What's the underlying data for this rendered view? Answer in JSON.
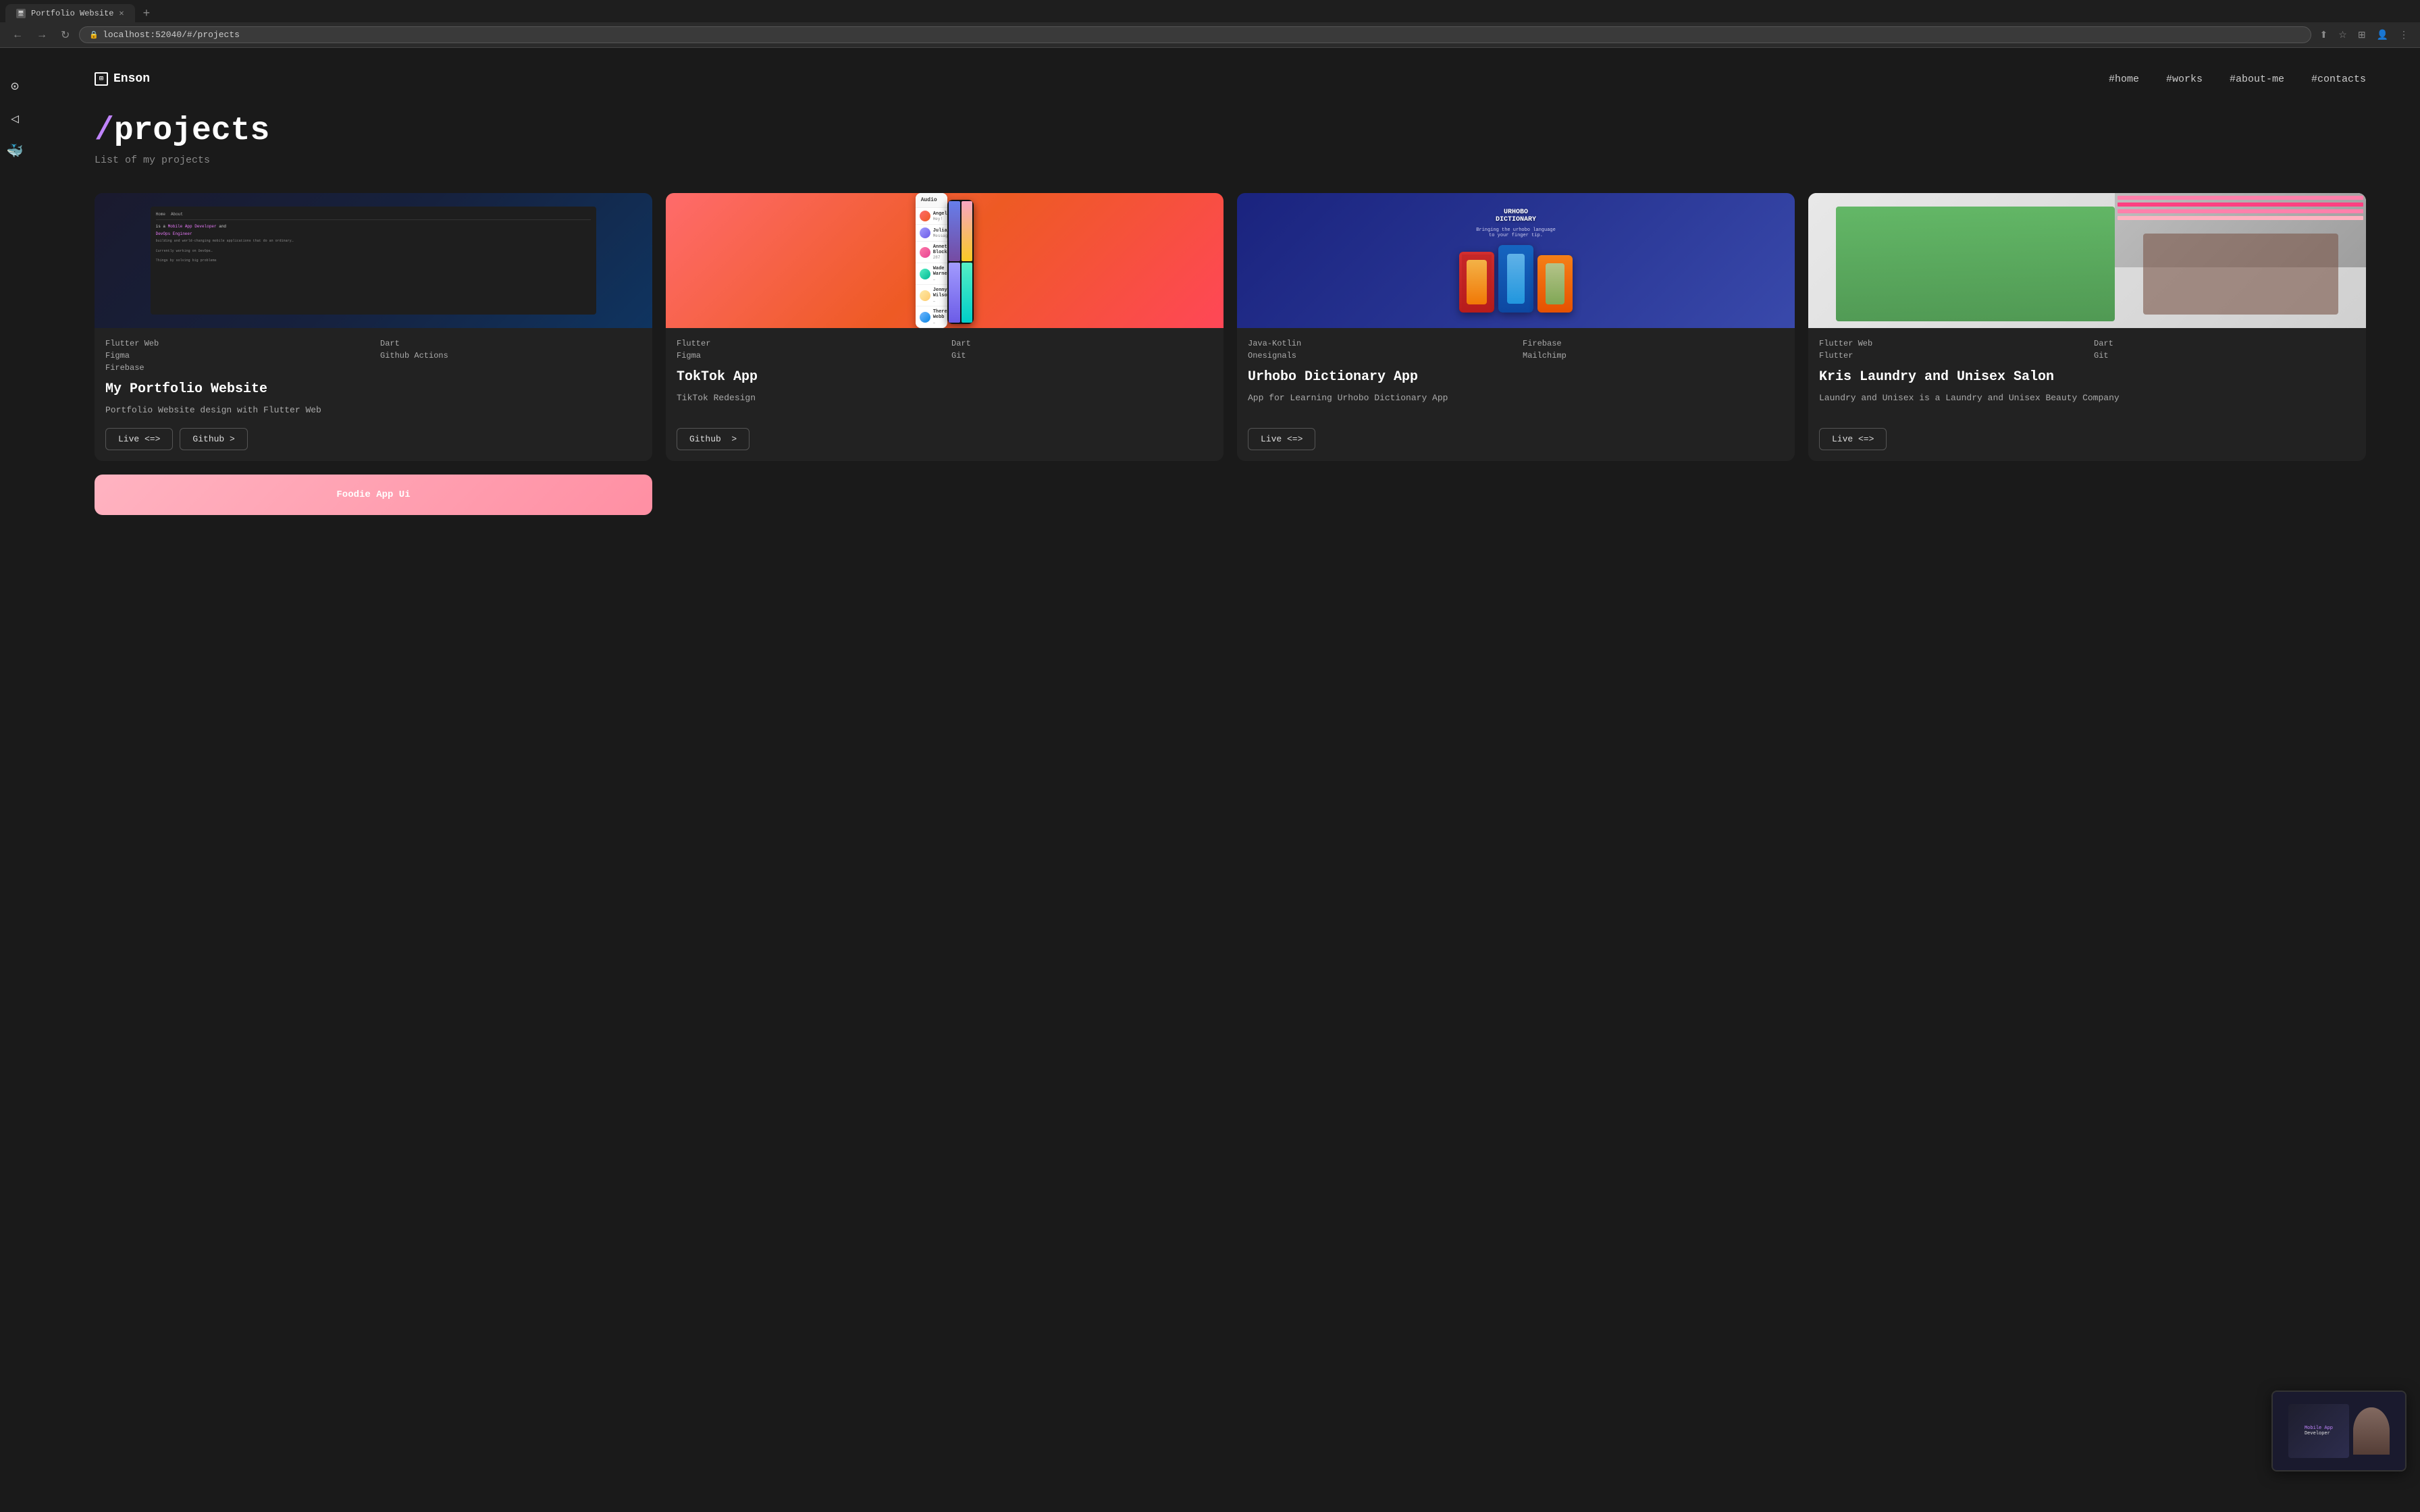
{
  "browser": {
    "tab_title": "Portfolio Website",
    "tab_favicon": "🖥",
    "new_tab_label": "+",
    "url": "localhost:52040/#/projects",
    "nav_back": "←",
    "nav_forward": "→",
    "nav_refresh": "↻",
    "nav_more": "⋮",
    "nav_bookmark": "☆",
    "nav_extensions": "⊞",
    "nav_account": "👤"
  },
  "sidebar": {
    "icons": [
      {
        "name": "github-icon",
        "symbol": "⊙",
        "label": "GitHub"
      },
      {
        "name": "flutter-icon",
        "symbol": "◁",
        "label": "Flutter"
      },
      {
        "name": "docker-icon",
        "symbol": "🐳",
        "label": "Docker"
      }
    ]
  },
  "header": {
    "logo_icon": "⊞",
    "logo_text": "Enson",
    "nav_items": [
      {
        "key": "home",
        "label": "#home"
      },
      {
        "key": "works",
        "label": "#works"
      },
      {
        "key": "about",
        "label": "#about-me"
      },
      {
        "key": "contacts",
        "label": "#contacts"
      }
    ]
  },
  "page": {
    "title_slash": "/",
    "title_text": "projects",
    "subtitle": "List of my projects"
  },
  "projects": [
    {
      "id": "portfolio",
      "tags": [
        "Flutter Web",
        "Dart",
        "Figma",
        "Github Actions",
        "Firebase",
        ""
      ],
      "name": "My Portfolio Website",
      "description": "Portfolio Website design with Flutter Web",
      "actions": [
        {
          "label": "Live <=>",
          "type": "live"
        },
        {
          "label": "Github  >",
          "type": "github"
        }
      ],
      "image_type": "portfolio"
    },
    {
      "id": "tiktok",
      "tags": [
        "Flutter",
        "Dart",
        "Figma",
        "Git"
      ],
      "name": "TokTok App",
      "description": "TikTok Redesign",
      "actions": [
        {
          "label": "Github  >",
          "type": "github"
        }
      ],
      "image_type": "tiktok"
    },
    {
      "id": "urhobo",
      "tags": [
        "Java-Kotlin",
        "Firebase",
        "Onesignals",
        "Mailchimp"
      ],
      "name": "Urhobo Dictionary App",
      "description": "App for Learning Urhobo Dictionary App",
      "actions": [
        {
          "label": "Live <=>",
          "type": "live"
        }
      ],
      "image_type": "urhobo"
    },
    {
      "id": "laundry",
      "tags": [
        "Flutter Web",
        "Dart",
        "Flutter",
        "Git"
      ],
      "name": "Kris Laundry and Unisex Salon",
      "description": "Laundry and Unisex is a Laundry and Unisex Beauty Company",
      "actions": [
        {
          "label": "Live <=>",
          "type": "live"
        }
      ],
      "image_type": "laundry"
    }
  ],
  "partial_projects": [
    {
      "id": "foodie",
      "name": "Foodie App Ui",
      "image_type": "foodie"
    }
  ],
  "colors": {
    "background": "#1a1a1a",
    "card_bg": "#222222",
    "accent_purple": "#c084fc",
    "text_primary": "#ffffff",
    "text_secondary": "#aaaaaa",
    "text_muted": "#888888",
    "border": "#444444"
  },
  "thumbnail": {
    "visible": true
  }
}
